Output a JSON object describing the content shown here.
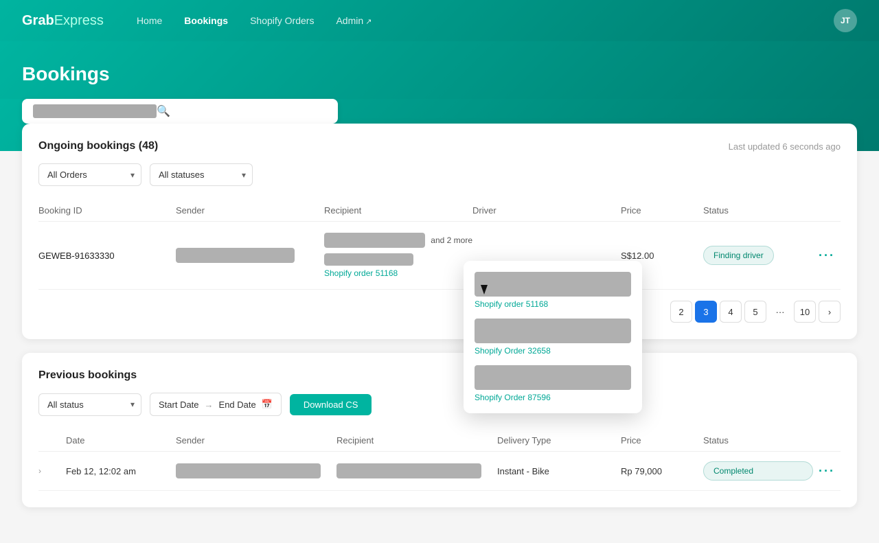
{
  "navbar": {
    "brand": "GrabExpress",
    "brand_grab": "Grab",
    "brand_express": "Express",
    "links": [
      {
        "label": "Home",
        "active": false,
        "external": false
      },
      {
        "label": "Bookings",
        "active": true,
        "external": false
      },
      {
        "label": "Shopify Orders",
        "active": false,
        "external": false
      },
      {
        "label": "Admin",
        "active": false,
        "external": true
      }
    ],
    "avatar_initials": "JT"
  },
  "hero": {
    "title": "Bookings"
  },
  "search": {
    "placeholder": ""
  },
  "ongoing": {
    "title": "Ongoing bookings (48)",
    "last_updated": "Last updated 6 seconds ago",
    "filter_orders": "All Orders",
    "filter_statuses": "All statuses",
    "table_headers": {
      "booking_id": "Booking ID",
      "sender": "Sender",
      "recipient": "Recipient",
      "driver": "Driver",
      "price": "Price",
      "status": "Status"
    },
    "rows": [
      {
        "booking_id": "GEWEB-91633330",
        "price": "S$12.00",
        "status": "Finding driver",
        "shopify_link": "Shopify order 51168"
      }
    ],
    "pagination": {
      "pages": [
        "2",
        "3",
        "4",
        "5",
        "...",
        "10"
      ],
      "active_page": "3"
    }
  },
  "previous": {
    "title": "Previous bookings",
    "filter_status": "All status",
    "start_date": "Start Date",
    "end_date": "End Date",
    "download_label": "Download CS",
    "table_headers": {
      "date": "Date",
      "sender": "Sender",
      "recipient": "Recipient",
      "delivery_type": "Delivery Type",
      "price": "Price",
      "status": "Status"
    },
    "rows": [
      {
        "date": "Feb 12, 12:02 am",
        "delivery_type": "Instant - Bike",
        "price": "Rp 79,000",
        "status": "Completed"
      }
    ]
  },
  "popup": {
    "items": [
      {
        "shopify_link": "Shopify order 51168"
      },
      {
        "shopify_link": "Shopify Order 32658"
      },
      {
        "shopify_link": "Shopify Order 87596"
      }
    ]
  },
  "colors": {
    "brand_green": "#00b4a0",
    "brand_dark": "#007a6e",
    "link_green": "#00a896",
    "status_green_bg": "#e8f5f3",
    "status_green_text": "#00876e"
  }
}
